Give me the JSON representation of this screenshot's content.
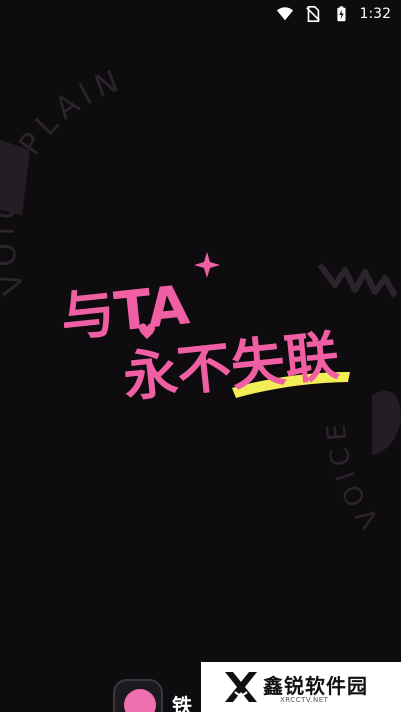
{
  "status_bar": {
    "time": "1:32",
    "icons": [
      "wifi-icon",
      "no-sim-icon",
      "battery-charging-icon"
    ]
  },
  "background": {
    "top_left_arc_text": "VOICE PLAIN",
    "bottom_right_arc_text": "VOICE"
  },
  "slogan": {
    "line1": "与TA",
    "line2": "永不失联",
    "color": "#f05fa4",
    "underline_color": "#f3ee55"
  },
  "brand": {
    "app_name": "铁",
    "icon_color": "#f06fae"
  },
  "watermark": {
    "title": "鑫锐软件园",
    "subtitle": "XRCCTV.NET"
  }
}
